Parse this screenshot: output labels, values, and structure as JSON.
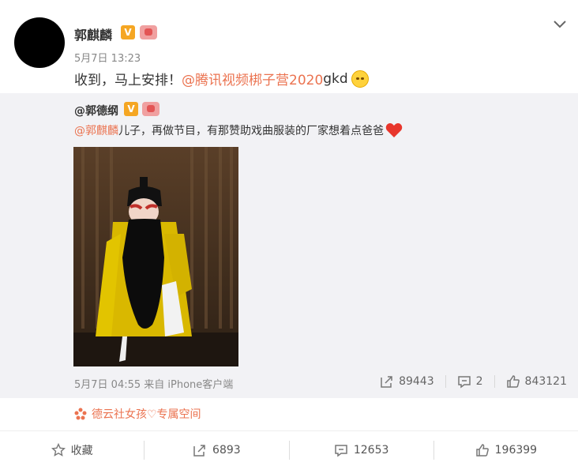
{
  "post": {
    "author": "郭麒麟",
    "time": "5月7日 13:23",
    "text_prefix": "收到，马上安排！",
    "mention": "@腾讯视频梆子营2020",
    "text_suffix": " gkd"
  },
  "repost": {
    "author": "@郭德纲",
    "mention": "@郭麒麟",
    "text": " 儿子，再做节目，有那赞助戏曲服装的厂家想着点爸爸",
    "meta": "5月7日 04:55 来自 iPhone客户端",
    "actions": {
      "forward": "89443",
      "comment": "2",
      "like": "843121"
    }
  },
  "fan_zone": "德云社女孩♡专属空间",
  "bottom": {
    "favorite": "收藏",
    "forward": "6893",
    "comment": "12653",
    "like": "196399"
  },
  "colors": {
    "accent": "#eb7350",
    "vip": "#f5a623"
  }
}
